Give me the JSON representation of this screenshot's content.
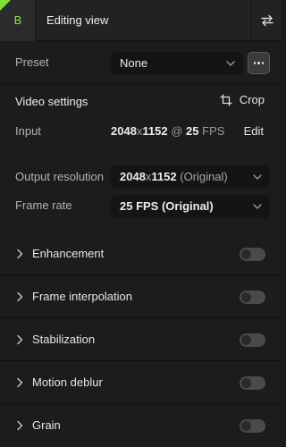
{
  "header": {
    "badge_letter": "B",
    "title": "Editing view",
    "swap_icon": "swap-arrows-icon",
    "accent_color": "#7be23a"
  },
  "preset": {
    "label": "Preset",
    "value": "None",
    "more_icon": "more-dots-icon"
  },
  "video_settings": {
    "title": "Video settings",
    "crop_label": "Crop",
    "crop_icon": "crop-icon",
    "input": {
      "label": "Input",
      "width": "2048",
      "times": "x",
      "height": "1152",
      "at": " @ ",
      "fps": "25",
      "fps_unit": " FPS",
      "edit_label": "Edit"
    },
    "output_resolution": {
      "label": "Output resolution",
      "width": "2048",
      "times": "x",
      "height": "1152",
      "note": " (Original)"
    },
    "frame_rate": {
      "label": "Frame rate",
      "value": "25 FPS (Original)"
    }
  },
  "features": [
    {
      "label": "Enhancement",
      "enabled": false
    },
    {
      "label": "Frame interpolation",
      "enabled": false
    },
    {
      "label": "Stabilization",
      "enabled": false
    },
    {
      "label": "Motion deblur",
      "enabled": false
    },
    {
      "label": "Grain",
      "enabled": false
    }
  ]
}
